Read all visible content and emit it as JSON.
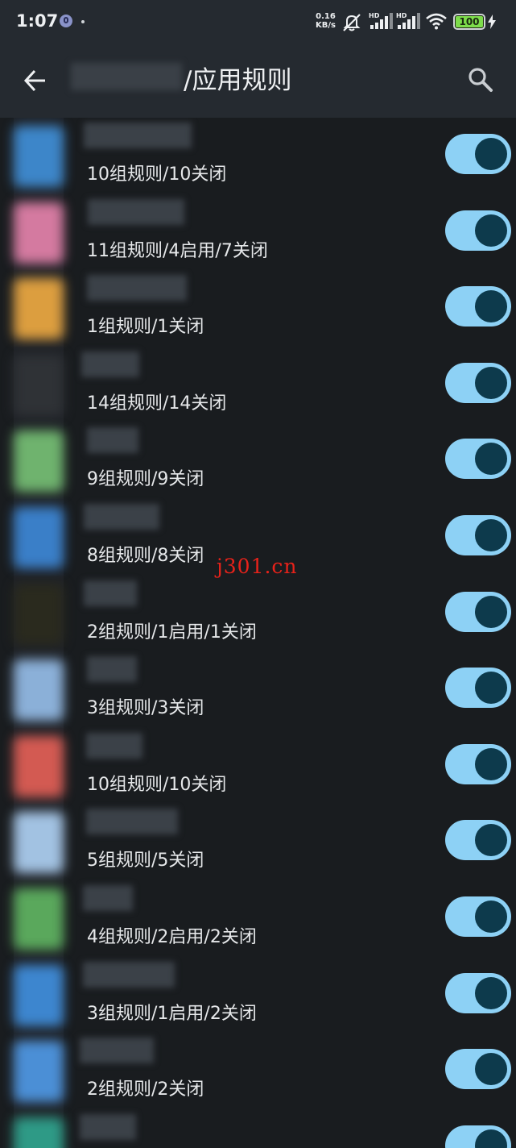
{
  "status": {
    "time": "1:07",
    "speed_value": "0.16",
    "speed_unit": "KB/s",
    "hd1": "HD",
    "hd2": "HD",
    "battery": "100"
  },
  "appbar": {
    "title": "/应用规则",
    "back_icon": "arrow-left-icon",
    "search_icon": "search-icon"
  },
  "rows": [
    {
      "desc": "10组规则/10关闭",
      "icon_color": "#3d86c9",
      "enabled": true
    },
    {
      "desc": "11组规则/4启用/7关闭",
      "icon_color": "#d47aa0",
      "enabled": true
    },
    {
      "desc": "1组规则/1关闭",
      "icon_color": "#dc9e3f",
      "enabled": true
    },
    {
      "desc": "14组规则/14关闭",
      "icon_color": "#2f3236",
      "enabled": true
    },
    {
      "desc": "9组规则/9关闭",
      "icon_color": "#6fb36e",
      "enabled": true
    },
    {
      "desc": "8组规则/8关闭",
      "icon_color": "#3a7fc8",
      "enabled": true
    },
    {
      "desc": "2组规则/1启用/1关闭",
      "icon_color": "#2a2a1e",
      "enabled": true
    },
    {
      "desc": "3组规则/3关闭",
      "icon_color": "#8bb0d8",
      "enabled": true
    },
    {
      "desc": "10组规则/10关闭",
      "icon_color": "#d35a52",
      "enabled": true
    },
    {
      "desc": "5组规则/5关闭",
      "icon_color": "#a2c2e2",
      "enabled": true
    },
    {
      "desc": "4组规则/2启用/2关闭",
      "icon_color": "#5aa85c",
      "enabled": true
    },
    {
      "desc": "3组规则/1启用/2关闭",
      "icon_color": "#3d86cf",
      "enabled": true
    },
    {
      "desc": "2组规则/2关闭",
      "icon_color": "#4b8fd6",
      "enabled": true
    },
    {
      "desc": "",
      "icon_color": "#2e9a86",
      "enabled": true
    }
  ],
  "watermark": "j301.cn",
  "colors": {
    "background": "#191c1f",
    "appbar": "#252a30",
    "switch_track": "#8dd1f5",
    "switch_thumb": "#0d3a4c",
    "watermark": "#e8221a"
  }
}
